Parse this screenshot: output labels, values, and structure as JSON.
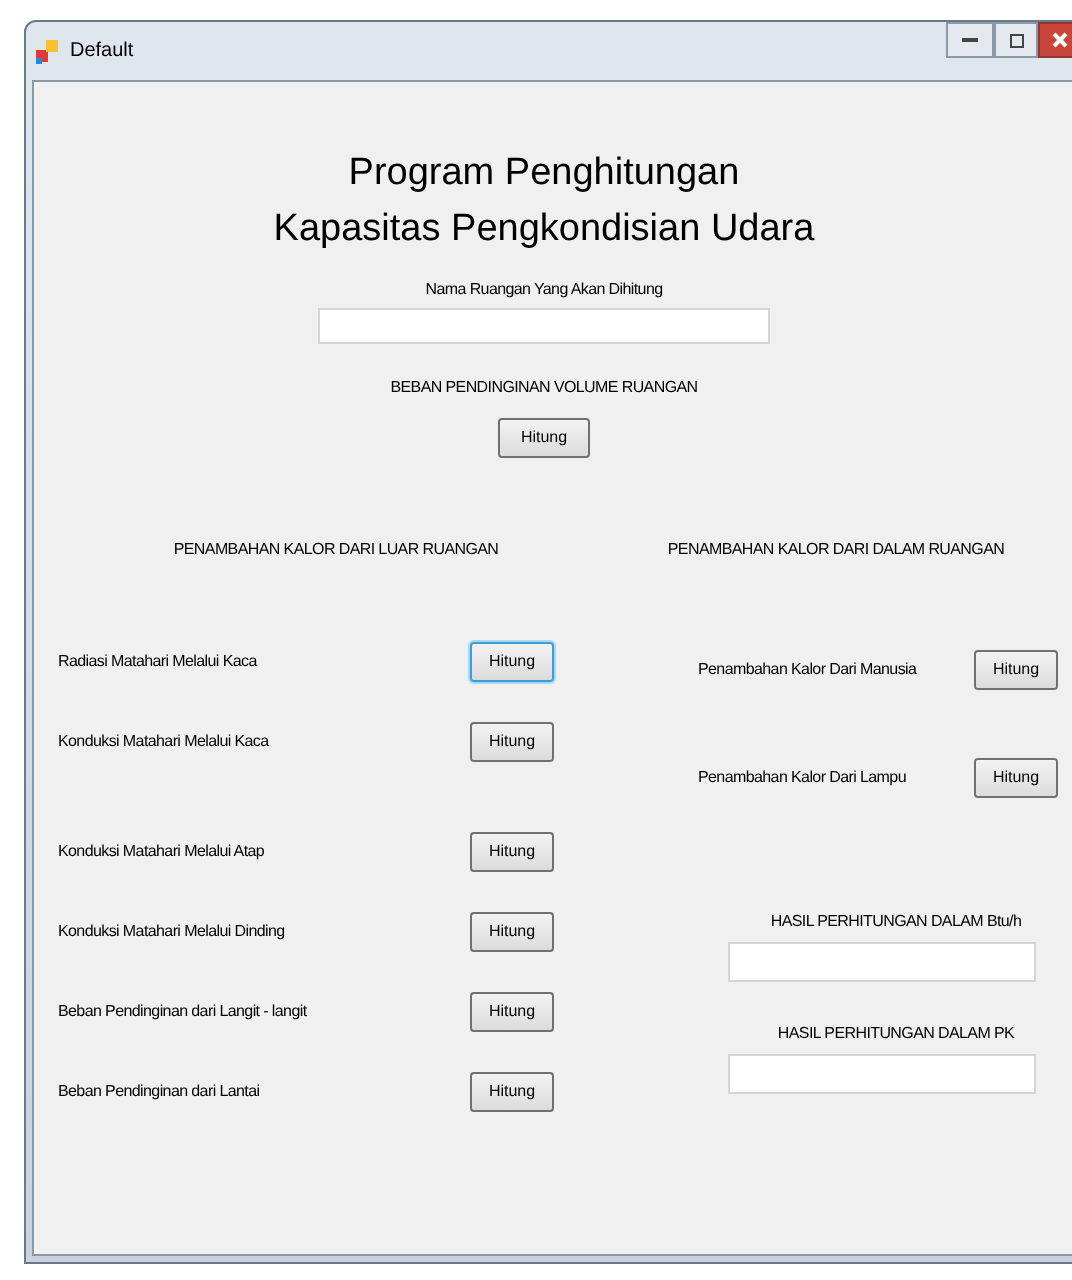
{
  "window": {
    "title": "Default"
  },
  "heading": [
    "Program Penghitungan",
    "Kapasitas Pengkondisian Udara"
  ],
  "room_name": {
    "label": "Nama Ruangan Yang Akan Dihitung"
  },
  "volume": {
    "label": "BEBAN PENDINGINAN VOLUME RUANGAN",
    "button": "Hitung"
  },
  "outside": {
    "title": "PENAMBAHAN KALOR DARI LUAR RUANGAN",
    "rows": [
      {
        "label": "Radiasi Matahari Melalui Kaca",
        "button": "Hitung",
        "focused": true
      },
      {
        "label": "Konduksi Matahari Melalui Kaca",
        "button": "Hitung",
        "focused": false
      },
      {
        "label": "Konduksi Matahari Melalui Atap",
        "button": "Hitung",
        "focused": false
      },
      {
        "label": "Konduksi Matahari Melalui Dinding",
        "button": "Hitung",
        "focused": false
      },
      {
        "label": "Beban Pendinginan dari Langit - langit",
        "button": "Hitung",
        "focused": false
      },
      {
        "label": "Beban Pendinginan dari Lantai",
        "button": "Hitung",
        "focused": false
      }
    ]
  },
  "inside": {
    "title": "PENAMBAHAN KALOR DARI DALAM RUANGAN",
    "rows": [
      {
        "label": "Penambahan Kalor Dari Manusia",
        "button": "Hitung",
        "focused": false
      },
      {
        "label": "Penambahan Kalor Dari Lampu",
        "button": "Hitung",
        "focused": false
      }
    ]
  },
  "results": [
    {
      "label": "HASIL PERHITUNGAN DALAM Btu/h"
    },
    {
      "label": "HASIL PERHITUNGAN DALAM PK"
    }
  ]
}
